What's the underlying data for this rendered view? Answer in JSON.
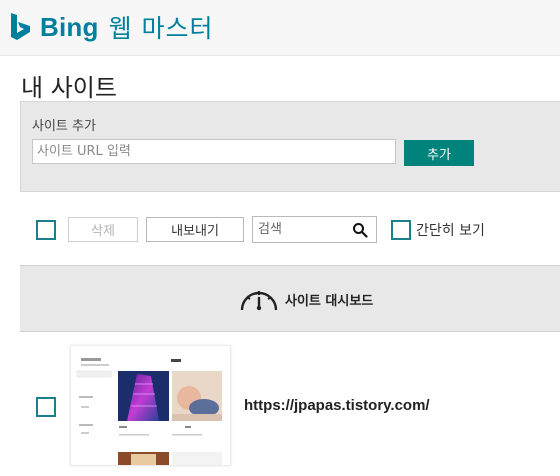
{
  "header": {
    "brand_name": "Bing",
    "product_name": "웹 마스터",
    "logo_icon": "bing-b-logo-icon",
    "brand_color": "#00809d"
  },
  "page": {
    "title": "내 사이트"
  },
  "add_site": {
    "title": "사이트 추가",
    "url_placeholder": "사이트 URL 입력",
    "url_value": "",
    "add_button_label": "추가",
    "button_color": "#00837a"
  },
  "toolbar": {
    "delete_label": "삭제",
    "export_label": "내보내기",
    "search_placeholder": "검색",
    "search_icon": "search-icon",
    "simple_view_label": "간단히 보기"
  },
  "dashboard": {
    "label": "사이트 대시보드",
    "icon": "gauge-icon"
  },
  "sites": [
    {
      "url": "https://jpapas.tistory.com/",
      "thumbnail_icon": "site-thumbnail"
    }
  ],
  "colors": {
    "checkbox_border": "#1a7f8e",
    "panel_bg": "#e8e8e8"
  }
}
